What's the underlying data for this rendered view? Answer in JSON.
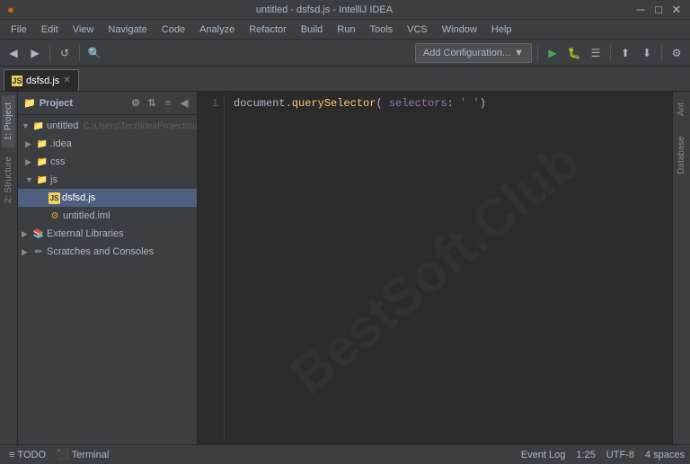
{
  "titlebar": {
    "project_name": "untitled",
    "file_name": "dsfsd.js",
    "app_name": "untitled - dsfsd.js - IntelliJ IDEA",
    "minimize": "─",
    "maximize": "□",
    "close": "✕"
  },
  "menubar": {
    "items": [
      {
        "label": "File"
      },
      {
        "label": "Edit"
      },
      {
        "label": "View"
      },
      {
        "label": "Navigate"
      },
      {
        "label": "Code"
      },
      {
        "label": "Analyze"
      },
      {
        "label": "Refactor"
      },
      {
        "label": "Build"
      },
      {
        "label": "Run"
      },
      {
        "label": "Tools"
      },
      {
        "label": "VCS"
      },
      {
        "label": "Window"
      },
      {
        "label": "Help"
      }
    ]
  },
  "toolbar": {
    "run_config_label": "Add Configuration..."
  },
  "tabs": {
    "active_tab": {
      "label": "dsfsd.js",
      "type": "js"
    }
  },
  "project_panel": {
    "title": "Project",
    "tree": [
      {
        "id": "untitled",
        "label": "untitled",
        "path": "C:\\Users\\Tecr\\IdeaProjects\\unt",
        "level": 0,
        "type": "module",
        "expanded": true,
        "arrow": "▼"
      },
      {
        "id": "idea",
        "label": ".idea",
        "level": 1,
        "type": "folder",
        "expanded": false,
        "arrow": "▶"
      },
      {
        "id": "css",
        "label": "css",
        "level": 1,
        "type": "folder",
        "expanded": false,
        "arrow": "▶"
      },
      {
        "id": "js",
        "label": "js",
        "level": 1,
        "type": "folder",
        "expanded": true,
        "arrow": "▼"
      },
      {
        "id": "dsfsd",
        "label": "dsfsd.js",
        "level": 2,
        "type": "js",
        "selected": true
      },
      {
        "id": "untitled_iml",
        "label": "untitled.iml",
        "level": 2,
        "type": "iml"
      },
      {
        "id": "external_libs",
        "label": "External Libraries",
        "level": 0,
        "type": "extlib",
        "expanded": false,
        "arrow": "▶"
      },
      {
        "id": "scratches",
        "label": "Scratches and Consoles",
        "level": 0,
        "type": "scratches",
        "expanded": false,
        "arrow": "▶"
      }
    ]
  },
  "editor": {
    "code_line": "document.querySelector( selectors: ' ' )",
    "line_number": "1"
  },
  "sidebar_left": {
    "tabs": [
      {
        "label": "1: Project"
      },
      {
        "label": "2: Structure"
      }
    ]
  },
  "sidebar_right": {
    "tabs": [
      {
        "label": "Ant"
      },
      {
        "label": "Database"
      }
    ]
  },
  "bottombar": {
    "todo_label": "TODO",
    "terminal_label": "Terminal",
    "event_log_label": "Event Log",
    "cursor_pos": "1:25",
    "encoding": "UTF-8",
    "indent": "4 spaces"
  },
  "watermark": {
    "line1": "BestSoft.Club"
  }
}
